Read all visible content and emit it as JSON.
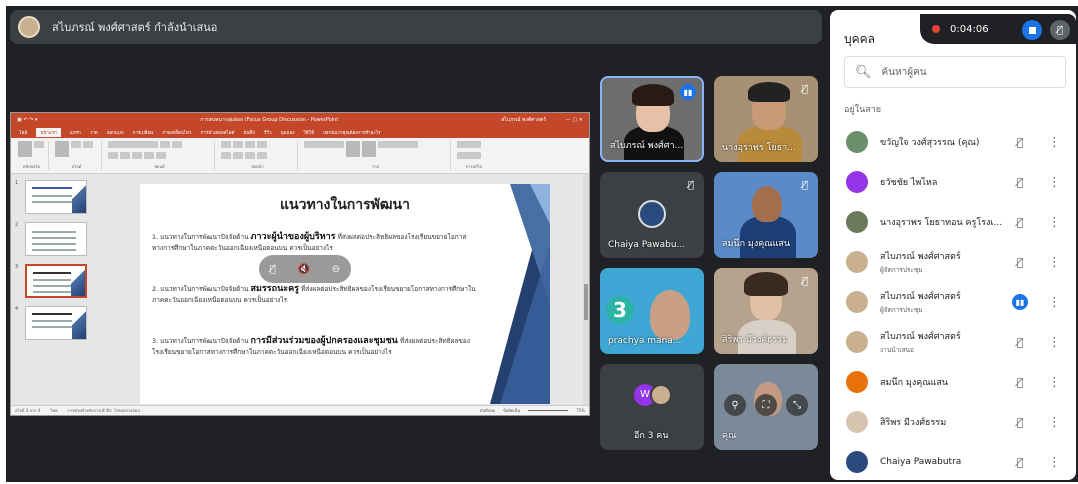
{
  "presenter_bar": {
    "text": "สไบภรณ์ พงศ์ศาสตร์ กำลังนำเสนอ"
  },
  "slide": {
    "heading": "แนวทางในการพัฒนา",
    "p1_pre": "1. แนวทางในการพัฒนาปัจจัยด้าน ",
    "p1_bold": "ภาวะผู้นำของผู้บริหาร",
    "p1_post": " ที่ส่งผลต่อประสิทธิผลของโรงเรียนขยายโอกาสทางการศึกษาในภาคตะวันออกเฉียงเหนือตอนบน ควรเป็นอย่างไร",
    "p2_pre": "2. แนวทางในการพัฒนาปัจจัยด้าน ",
    "p2_bold": "สมรรถนะครู",
    "p2_post": " ที่ส่งผลต่อประสิทธิผลของโรงเรียนขยายโอกาสทางการศึกษาในภาคตะวันออกเฉียงเหนือตอนบน ควรเป็นอย่างไร",
    "p3_pre": "3. แนวทางในการพัฒนาปัจจัยด้าน ",
    "p3_bold": "การมีส่วนร่วมของผู้ปกครองและชุมชน",
    "p3_post": " ที่ส่งผลต่อประสิทธิผลของโรงเรียนขยายโอกาสทางการศึกษาในภาคตะวันออกเฉียงเหนือตอนบน ควรเป็นอย่างไร"
  },
  "ppt": {
    "title": "การสนทนากลุ่มย่อย (Focus Group Discussion - PowerPoint",
    "account": "สไบภรณ์ พงศ์ศาสตร์",
    "tabs": [
      "ไฟล์",
      "หน้าแรก",
      "แทรก",
      "วาด",
      "ออกแบบ",
      "การเปลี่ยน",
      "ภาพเคลื่อนไหว",
      "การนำเสนอสไลด์",
      "บันทึก",
      "รีวิว",
      "มุมมอง",
      "วิธีใช้",
      "บอกฉันว่าคุณต้องการทำอะไร"
    ],
    "active_tab_index": 1,
    "thumb_numbers": [
      "1",
      "2",
      "3",
      "4"
    ],
    "status_left": "สไลด์ 3 จาก 4",
    "status_lang": "ไทย",
    "status_access": "การช่วยสำหรับการเข้าถึง: โปรดตรวจสอบ",
    "status_notes": "บันทึกย่อ",
    "status_comments": "ข้อคิดเห็น",
    "status_zoom": "75%"
  },
  "tiles": [
    {
      "label": "สไบภรณ์ พงศ์ศา...",
      "mic": "active"
    },
    {
      "label": "นางอุราพร โยธา...",
      "mic": "muted"
    },
    {
      "label": "Chaiya Pawabu...",
      "mic": "muted"
    },
    {
      "label": "สมนึก มุงคุณแสน",
      "mic": "muted"
    },
    {
      "label": "prachya mana...",
      "mic": "muted"
    },
    {
      "label": "สิริพร มีวงศ์ธรรม",
      "mic": "muted"
    },
    {
      "label": "อีก 3 คน",
      "mic": "none"
    },
    {
      "label": "คุณ",
      "mic": "none"
    }
  ],
  "tile3_avatar_letter": "W",
  "panel": {
    "title": "บุคคล",
    "search_placeholder": "ค้นหาผู้คน",
    "section": "อยู่ในสาย",
    "people": [
      {
        "name": "ขวัญใจ วงศ์สุวรรณ (คุณ)",
        "role": "",
        "mic": "muted",
        "color": "#6b8e6b"
      },
      {
        "name": "ธวัชชัย ไพไหล",
        "role": "",
        "mic": "muted",
        "color": "#9334e6"
      },
      {
        "name": "นางอุราพร โยธาทอน ครูโรงเ...",
        "role": "",
        "mic": "muted",
        "color": "#6b7a5a"
      },
      {
        "name": "สไบภรณ์ พงศ์ศาสตร์",
        "role": "ผู้จัดการประชุม",
        "mic": "muted",
        "color": "#c9b08f"
      },
      {
        "name": "สไบภรณ์ พงศ์ศาสตร์",
        "role": "ผู้จัดการประชุม",
        "mic": "active",
        "color": "#c9b08f"
      },
      {
        "name": "สไบภรณ์ พงศ์ศาสตร์",
        "role": "งานนำเสนอ",
        "mic": "muted",
        "color": "#c9b08f"
      },
      {
        "name": "สมนึก มุงคุณแสน",
        "role": "",
        "mic": "muted",
        "color": "#e8710a"
      },
      {
        "name": "สิริพร มีวงศ์ธรรม",
        "role": "",
        "mic": "muted",
        "color": "#d6c6b0"
      },
      {
        "name": "Chaiya Pawabutra",
        "role": "",
        "mic": "muted",
        "color": "#2b4b7e"
      }
    ]
  },
  "recording": {
    "time": "0:04:06"
  }
}
